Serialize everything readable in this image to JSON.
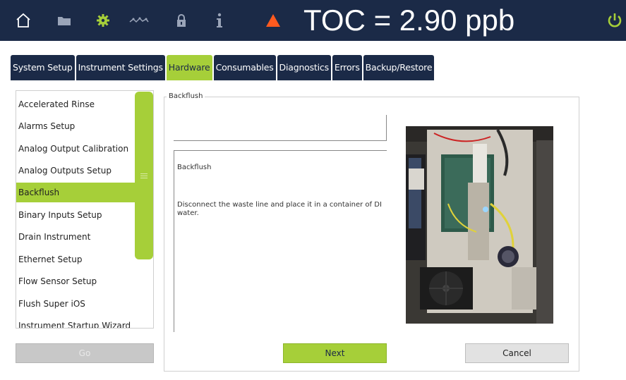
{
  "topbar": {
    "toc_readout": "TOC = 2.90 ppb",
    "icons": [
      "home-icon",
      "folder-icon",
      "gear-icon",
      "trend-icon",
      "lock-icon",
      "info-icon",
      "warning-icon",
      "power-icon"
    ]
  },
  "tabs": [
    {
      "label": "System Setup"
    },
    {
      "label": "Instrument Settings"
    },
    {
      "label": "Hardware"
    },
    {
      "label": "Consumables"
    },
    {
      "label": "Diagnostics"
    },
    {
      "label": "Errors"
    },
    {
      "label": "Backup/Restore"
    }
  ],
  "list": {
    "items": [
      {
        "label": "Accelerated Rinse"
      },
      {
        "label": "Alarms Setup"
      },
      {
        "label": "Analog Output Calibration"
      },
      {
        "label": "Analog Outputs Setup"
      },
      {
        "label": "Backflush"
      },
      {
        "label": "Binary Inputs Setup"
      },
      {
        "label": "Drain Instrument"
      },
      {
        "label": "Ethernet Setup"
      },
      {
        "label": "Flow Sensor Setup"
      },
      {
        "label": "Flush Super iOS"
      },
      {
        "label": "Instrument Startup Wizard"
      }
    ],
    "button_label": "Go"
  },
  "main": {
    "legend": "Backflush",
    "input_value": "",
    "desc_title": "Backflush",
    "desc_body": "Disconnect the waste line and place it in a container of DI water."
  },
  "buttons": {
    "next_label": "Next",
    "cancel_label": "Cancel"
  },
  "colors": {
    "topbar": "#1b2a47",
    "accent": "#a6cf39",
    "warning": "#ff5a1f"
  }
}
